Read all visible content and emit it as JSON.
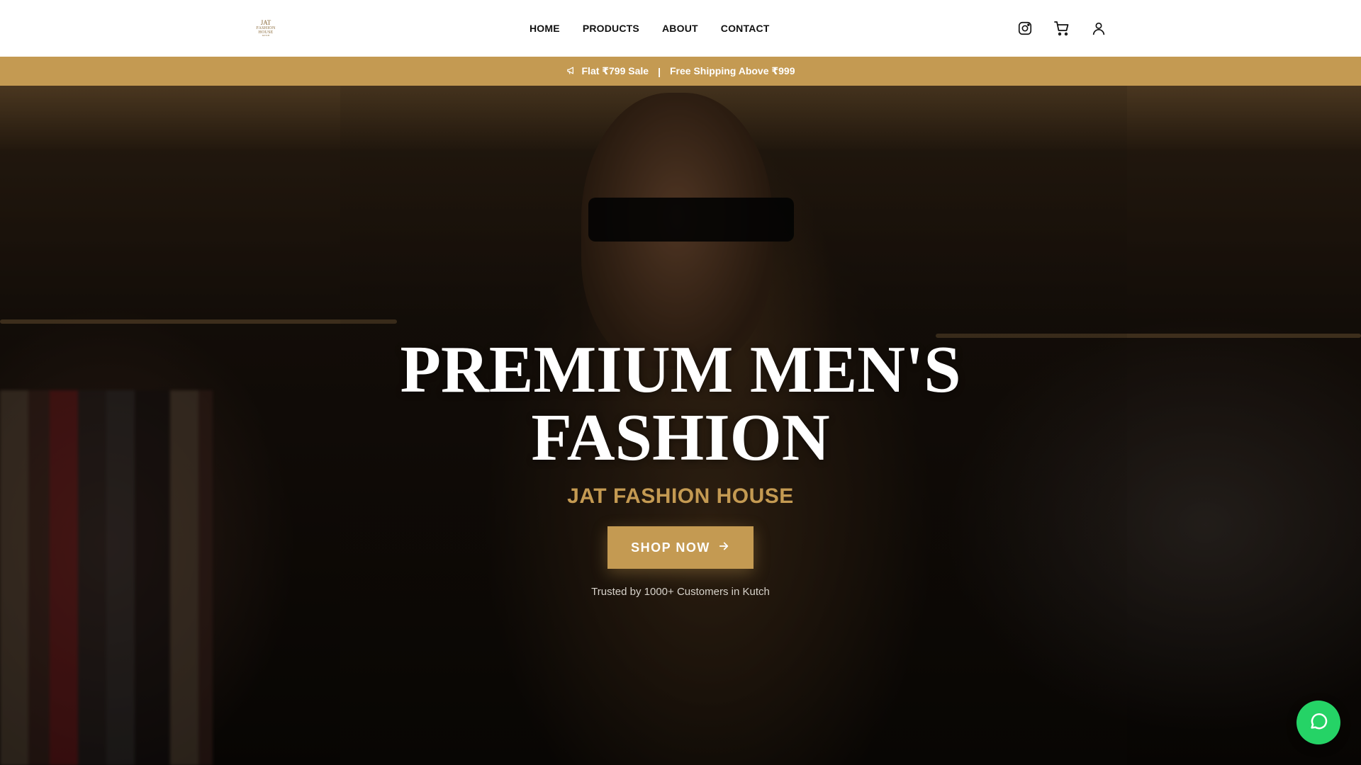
{
  "brand": {
    "logo_line1": "JAT",
    "logo_line2": "FASHION HOUSE",
    "logo_line3": "KUTCH"
  },
  "nav": {
    "items": [
      {
        "label": "HOME"
      },
      {
        "label": "PRODUCTS"
      },
      {
        "label": "ABOUT"
      },
      {
        "label": "CONTACT"
      }
    ]
  },
  "header_icons": [
    "instagram-icon",
    "cart-icon",
    "user-icon"
  ],
  "promo": {
    "icon": "megaphone-icon",
    "offer": "Flat ₹799 Sale",
    "separator": "|",
    "shipping": "Free Shipping Above ₹999"
  },
  "hero": {
    "title_line1": "PREMIUM MEN'S",
    "title_line2": "FASHION",
    "subtitle": "JAT FASHION HOUSE",
    "cta_label": "SHOP NOW",
    "cta_icon": "arrow-right-icon",
    "trust_text": "Trusted by 1000+ Customers in Kutch"
  },
  "floating": {
    "chat_icon": "whatsapp-icon"
  },
  "colors": {
    "accent": "#c49a52",
    "header_bg": "#ffffff",
    "chat_green": "#25d366"
  }
}
